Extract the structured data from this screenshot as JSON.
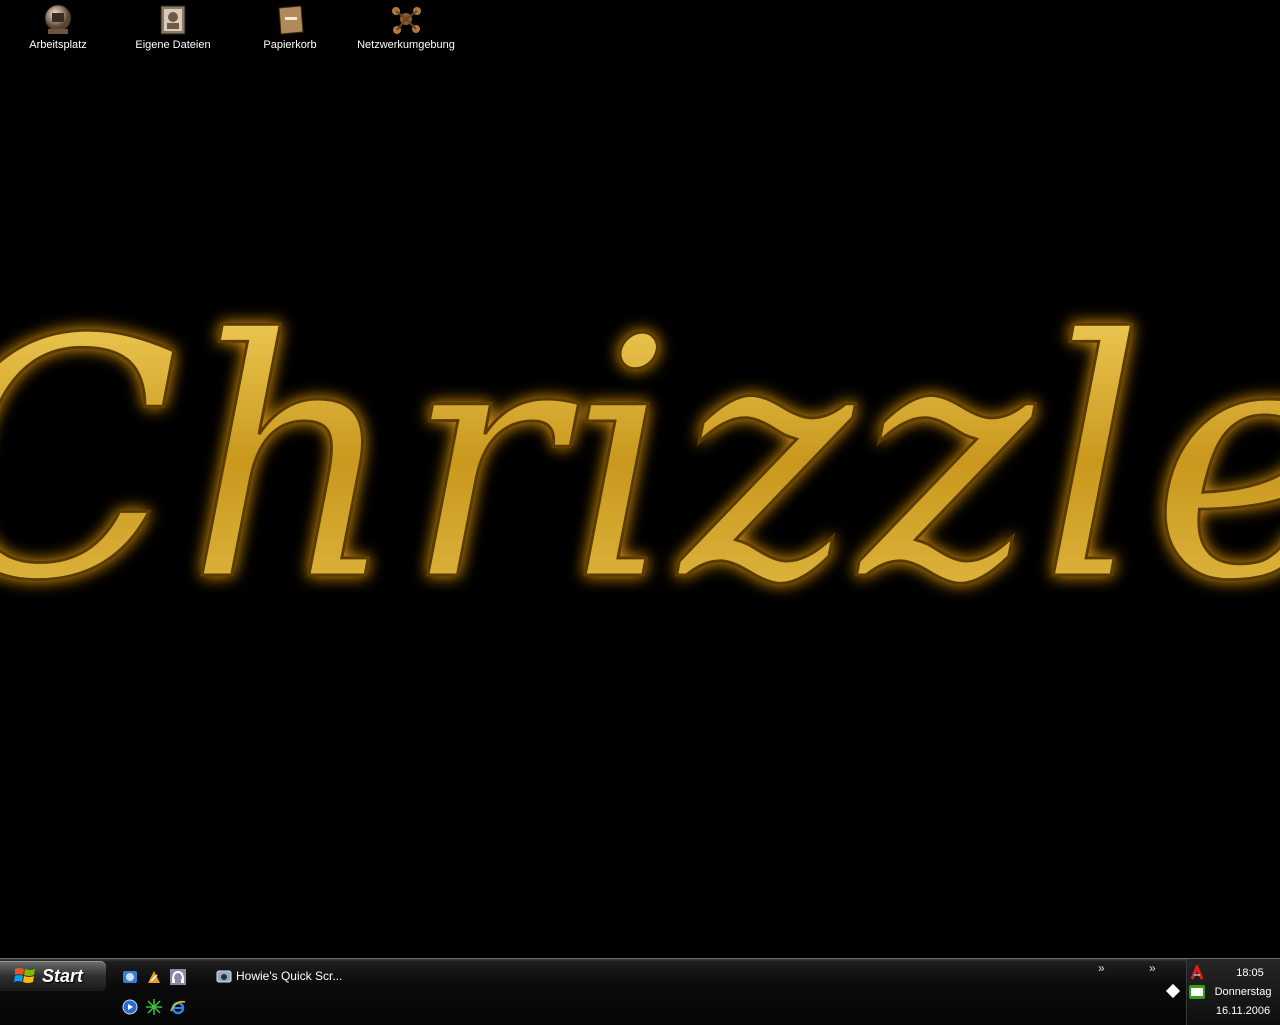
{
  "desktop": {
    "icons": [
      {
        "label": "Arbeitsplatz",
        "icon": "my-computer-icon"
      },
      {
        "label": "Eigene Dateien",
        "icon": "my-documents-icon"
      },
      {
        "label": "Papierkorb",
        "icon": "recycle-bin-icon"
      },
      {
        "label": "Netzwerkumgebung",
        "icon": "network-places-icon"
      }
    ],
    "wallpaper_text": "Chrizzle",
    "wallpaper_color": "#d4a52a"
  },
  "taskbar": {
    "start_label": "Start",
    "quick_launch": [
      "outlook-express-icon",
      "winamp-icon",
      "headphones-icon",
      "media-player-icon",
      "sparkle-icon",
      "internet-explorer-icon"
    ],
    "task_title": "Howie's Quick Scr...",
    "tray": {
      "time": "18:05",
      "day": "Donnerstag",
      "date": "16.11.2006",
      "icons": [
        "antivir-umbrella-icon",
        "nvidia-icon"
      ]
    }
  },
  "colors": {
    "background": "#000000",
    "taskbar": "#0b0b0b",
    "gold": "#e2b93b"
  }
}
